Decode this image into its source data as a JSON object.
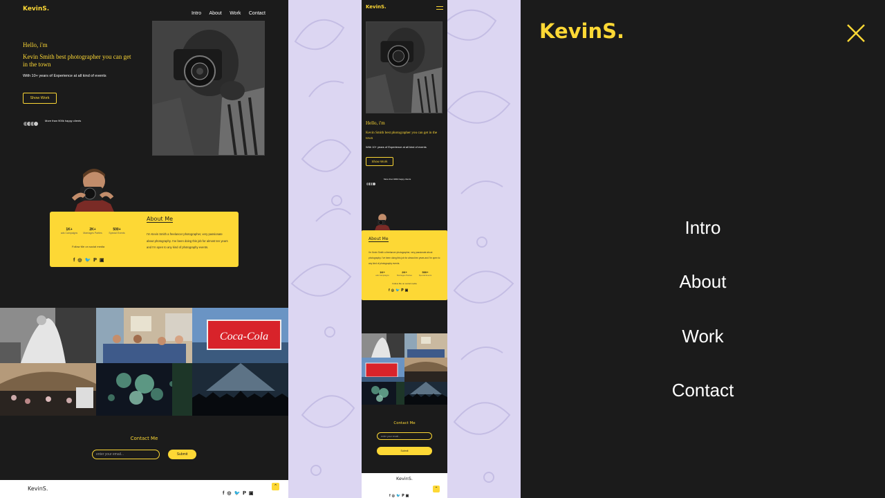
{
  "brand": "KevinS.",
  "nav": [
    "Intro",
    "About",
    "Work",
    "Contact"
  ],
  "hero": {
    "greeting": "Hello, i'm",
    "headline": "Kevin Smith best photographer you can get in the town",
    "experience": "With 10+ years of Experience at all kind of events",
    "button": "Show Work",
    "clients": "More than 900k happy clients"
  },
  "about": {
    "title": "About Me",
    "text": "I'm Kevin Smith a freelancer photographer, very passionate about photography. I've been doing this job for almost ten years and I'm open to any kind of photography events.",
    "stats": [
      {
        "value": "1K+",
        "label": "ads Campaigns"
      },
      {
        "value": "2K+",
        "label": "Marriages Parties"
      },
      {
        "value": "500+",
        "label": "Special Events"
      }
    ],
    "follow": "Follow Me on social media",
    "follow_mobile": "Follow Me on social media"
  },
  "gallery_sign": "Coca-Cola",
  "contact": {
    "title": "Contact Me",
    "placeholder": "enter your email...",
    "submit": "Submit"
  },
  "footer_brand": "KevinS.",
  "socials": [
    "f",
    "◎",
    "🐦",
    "𝐏",
    "▣"
  ],
  "menu": [
    "Intro",
    "About",
    "Work",
    "Contact"
  ],
  "colors": {
    "accent": "#fdd835",
    "dark": "#1b1b1b",
    "lavender": "#dcd6f2"
  }
}
